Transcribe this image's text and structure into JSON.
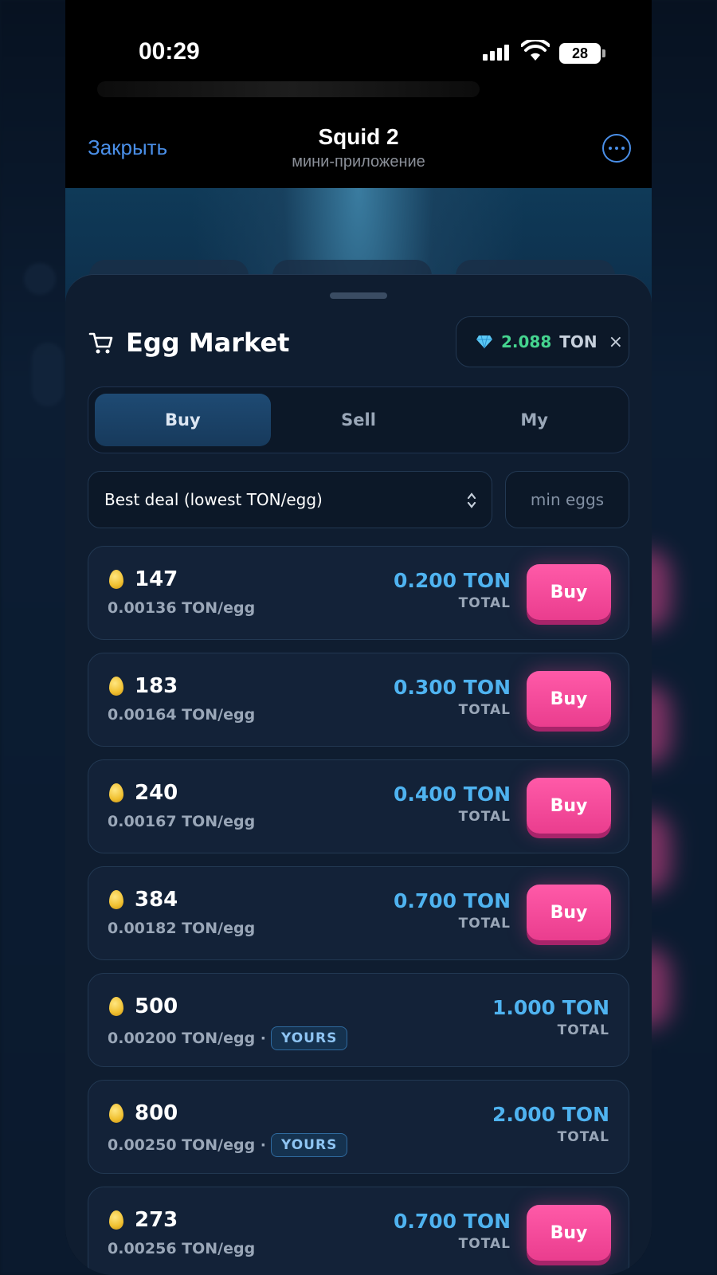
{
  "status_bar": {
    "time": "00:29",
    "battery": "28"
  },
  "telegram": {
    "close_label": "Закрыть",
    "title": "Squid 2",
    "subtitle": "мини-приложение"
  },
  "market": {
    "title": "Egg Market",
    "balance_value": "2.088",
    "balance_unit": "TON",
    "balance_close": "×"
  },
  "tabs": [
    {
      "label": "Buy",
      "active": true
    },
    {
      "label": "Sell",
      "active": false
    },
    {
      "label": "My",
      "active": false
    }
  ],
  "filters": {
    "sort_value": "Best deal (lowest TON/egg)",
    "min_eggs_placeholder": "min eggs"
  },
  "buy_label": "Buy",
  "total_label": "TOTAL",
  "yours_label": "YOURS",
  "listings": [
    {
      "eggs": "147",
      "per_egg": "0.00136 TON/egg",
      "total": "0.200 TON",
      "own": false
    },
    {
      "eggs": "183",
      "per_egg": "0.00164 TON/egg",
      "total": "0.300 TON",
      "own": false
    },
    {
      "eggs": "240",
      "per_egg": "0.00167 TON/egg",
      "total": "0.400 TON",
      "own": false
    },
    {
      "eggs": "384",
      "per_egg": "0.00182 TON/egg",
      "total": "0.700 TON",
      "own": false
    },
    {
      "eggs": "500",
      "per_egg": "0.00200 TON/egg ·",
      "total": "1.000 TON",
      "own": true
    },
    {
      "eggs": "800",
      "per_egg": "0.00250 TON/egg ·",
      "total": "2.000 TON",
      "own": true
    },
    {
      "eggs": "273",
      "per_egg": "0.00256 TON/egg",
      "total": "0.700 TON",
      "own": false
    }
  ],
  "colors": {
    "accent_blue": "#4fb3f0",
    "buy_pink": "#ff5aa8",
    "balance_green": "#45d48f",
    "link_blue": "#4a8fe8"
  }
}
